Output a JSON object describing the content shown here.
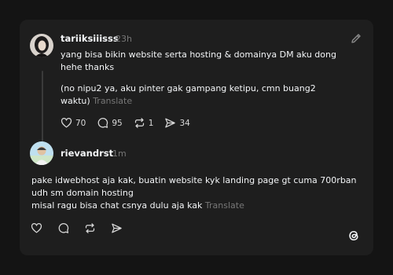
{
  "post": {
    "username": "tariiksiiisss",
    "time": "23h",
    "paragraph1": "yang bisa bikin website serta hosting & domainya DM aku dong\nhehe thanks",
    "paragraph2": "(no nipu2 ya, aku pinter gak gampang ketipu, cmn buang2\nwaktu)",
    "translate": "Translate",
    "likes": "70",
    "replies": "95",
    "reposts": "1",
    "shares": "34"
  },
  "reply": {
    "username": "rievandrst",
    "time": "1m",
    "text": "pake idwebhost aja kak, buatin website kyk landing page gt cuma 700rban\nudh sm domain hosting\nmisal ragu bisa chat csnya dulu aja kak",
    "translate": "Translate"
  },
  "icons": {
    "edit": "pencil-icon",
    "like": "heart-icon",
    "reply": "comment-icon",
    "repost": "repost-icon",
    "share": "send-icon",
    "logo": "threads-logo-icon"
  },
  "colors": {
    "background": "#141414",
    "card": "#1e1e1e",
    "text": "#f3f5f7",
    "muted": "#777777"
  }
}
